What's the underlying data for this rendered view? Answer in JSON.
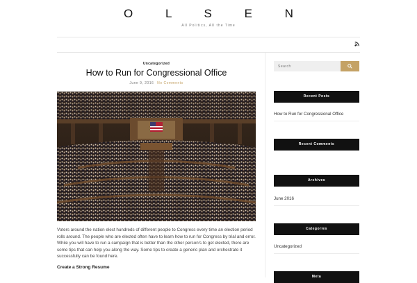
{
  "site": {
    "title": "O L S E N",
    "tagline": "All Politics, All the Time"
  },
  "nav": {
    "rss_icon": "rss-icon"
  },
  "post": {
    "category": "Uncategorized",
    "title": "How to Run for Congressional Office",
    "date": "June 9, 2016",
    "comments_link": "No Comments",
    "image_alt": "Joint session of Congress in the House chamber",
    "body": "Voters around the nation elect hundreds of different people to Congress every time an election period rolls around. The people who are elected often have to learn how to run for Congress by trial and error. While you will have to run a campaign that is better than the other person's to get elected, there are some tips that can help you along the way. Some tips to create a generic plan and orchestrate it successfully can be found here.",
    "subheading": "Create a Strong Resume"
  },
  "sidebar": {
    "search": {
      "placeholder": "Search",
      "button_icon": "search-icon"
    },
    "recent_posts": {
      "title": "Recent Posts",
      "items": [
        "How to Run for Congressional Office"
      ]
    },
    "recent_comments": {
      "title": "Recent Comments"
    },
    "archives": {
      "title": "Archives",
      "items": [
        "June 2016"
      ]
    },
    "categories": {
      "title": "Categories",
      "items": [
        "Uncategorized"
      ]
    },
    "meta": {
      "title": "Meta"
    }
  },
  "colors": {
    "accent": "#c4a265",
    "widget_header": "#111111"
  }
}
